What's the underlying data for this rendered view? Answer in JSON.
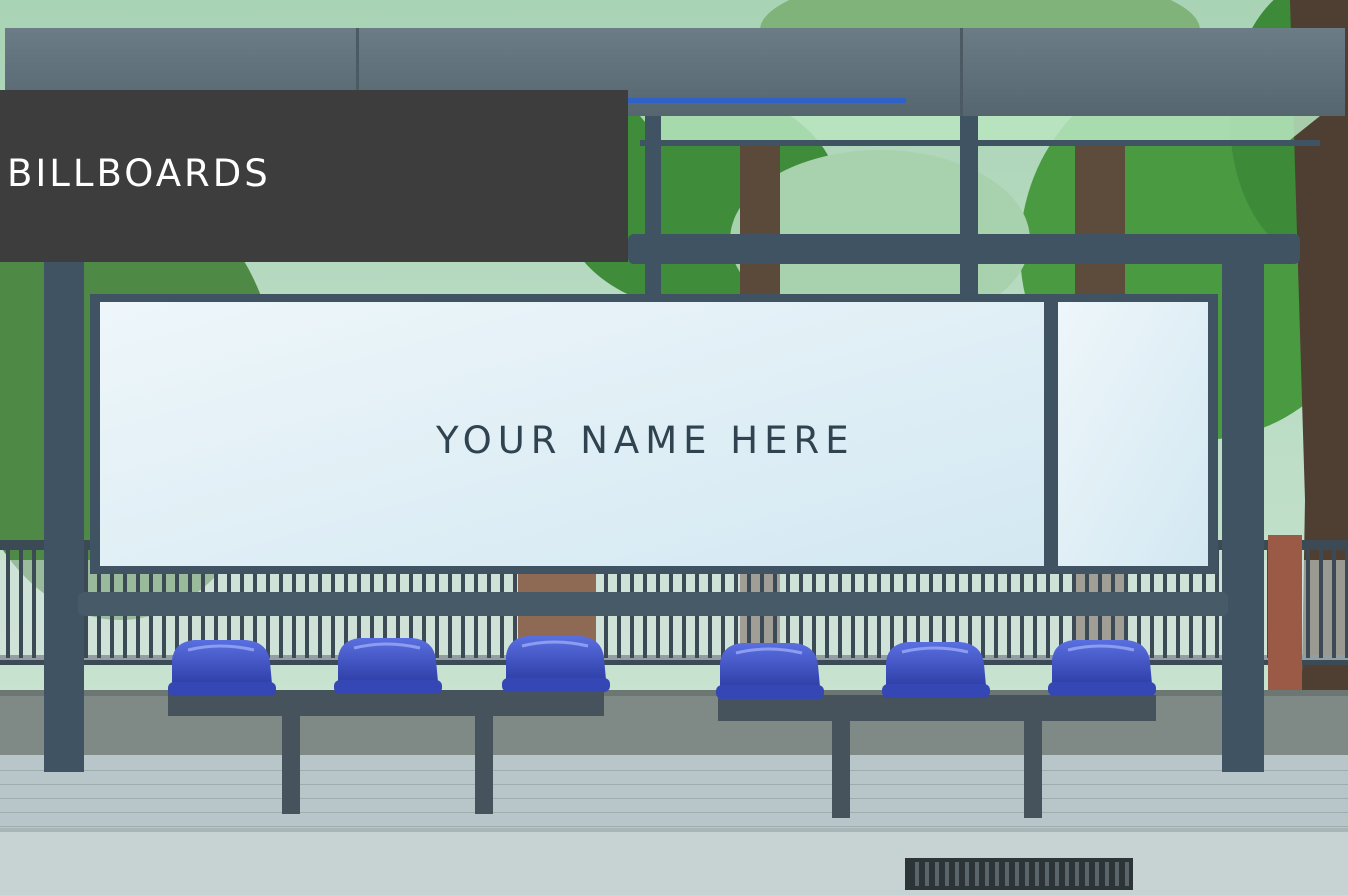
{
  "heading": {
    "label": "BILLBOARDS"
  },
  "billboard": {
    "main_text": "YOUR NAME HERE"
  },
  "photo": {
    "seat_count": 6,
    "colors": {
      "panel": "#3d3d3d",
      "billboard": "#dcecf4",
      "frame": "#3f5363",
      "seat": "#3e51c2",
      "foliage": "#3f8c3a",
      "pavement": "#b8c6c9"
    }
  }
}
